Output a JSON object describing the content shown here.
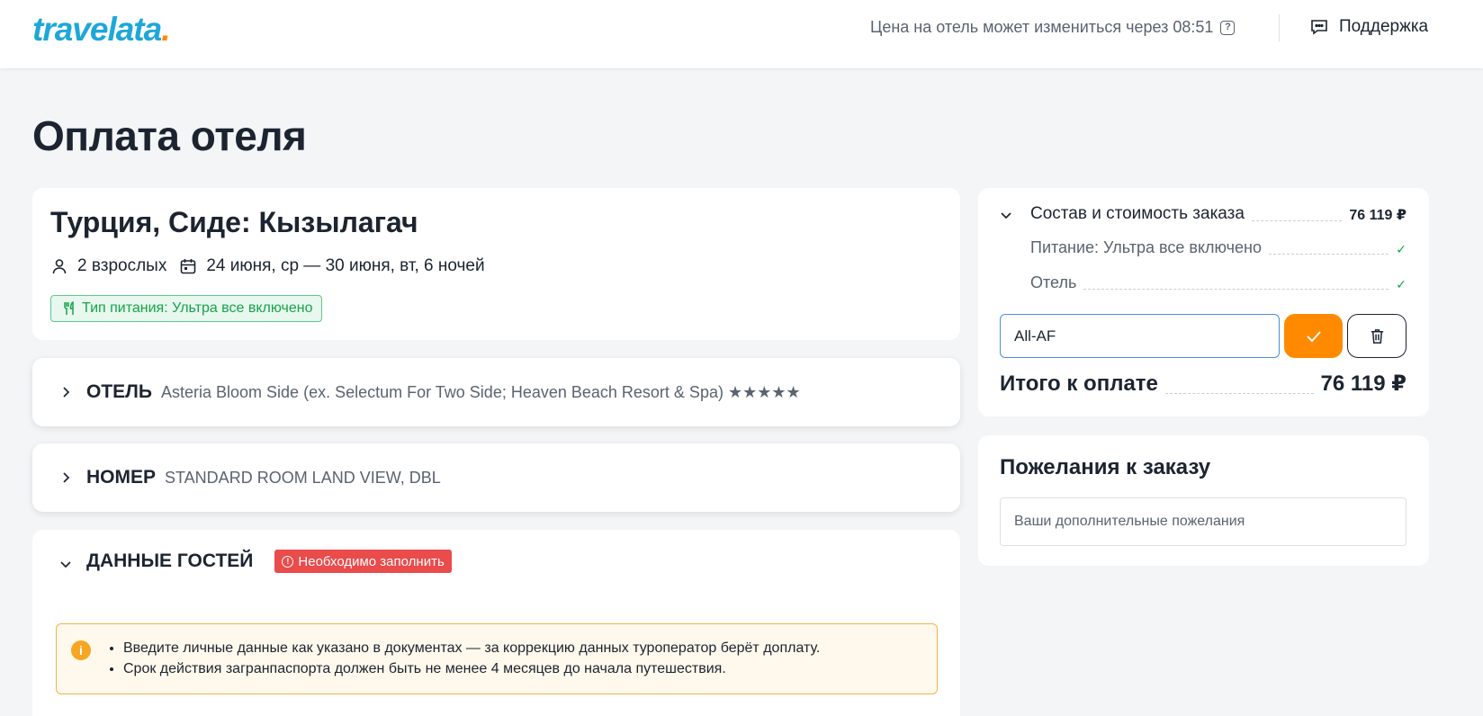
{
  "header": {
    "logo_text": "travelata",
    "logo_dot": ".",
    "timer_text": "Цена на отель может измениться через 08:51",
    "support_label": "Поддержка"
  },
  "page_title": "Оплата отеля",
  "trip": {
    "title": "Турция, Сиде: Кызылагач",
    "guests": "2 взрослых",
    "dates": "24 июня, ср — 30 июня, вт, 6 ночей",
    "meal_badge": "Тип питания: Ультра все включено"
  },
  "hotel_section": {
    "label": "ОТЕЛЬ",
    "value": "Asteria Bloom Side (ex. Selectum For Two Side; Heaven Beach Resort & Spa) ★★★★★"
  },
  "room_section": {
    "label": "НОМЕР",
    "value": "STANDARD ROOM LAND VIEW, DBL"
  },
  "guests_section": {
    "label": "ДАННЫЕ ГОСТЕЙ",
    "badge": "Необходимо заполнить",
    "notices": [
      "Введите личные данные как указано в документах — за коррекцию данных туроператор берёт доплату.",
      "Срок действия загранпаспорта должен быть не менее 4 месяцев до начала путешествия."
    ]
  },
  "summary": {
    "title": "Состав и стоимость заказа",
    "title_price": "76 119 ₽",
    "items": [
      {
        "label": "Питание: Ультра все включено",
        "status": "✓"
      },
      {
        "label": "Отель",
        "status": "✓"
      }
    ],
    "promo_value": "All-AF",
    "total_label": "Итого к оплате",
    "total_value": "76 119 ₽"
  },
  "wishes": {
    "title": "Пожелания к заказу",
    "placeholder": "Ваши дополнительные пожелания"
  },
  "colors": {
    "brand_blue": "#1ea7d9",
    "brand_orange": "#ff8a00",
    "success": "#16a34a",
    "danger": "#ea4b4b",
    "warning_border": "#f3b34a"
  },
  "icons": [
    "user-icon",
    "calendar-icon",
    "fork-knife-icon",
    "chevron-right-icon",
    "chevron-down-icon",
    "check-icon",
    "trash-icon",
    "chat-icon",
    "question-icon",
    "info-icon"
  ]
}
